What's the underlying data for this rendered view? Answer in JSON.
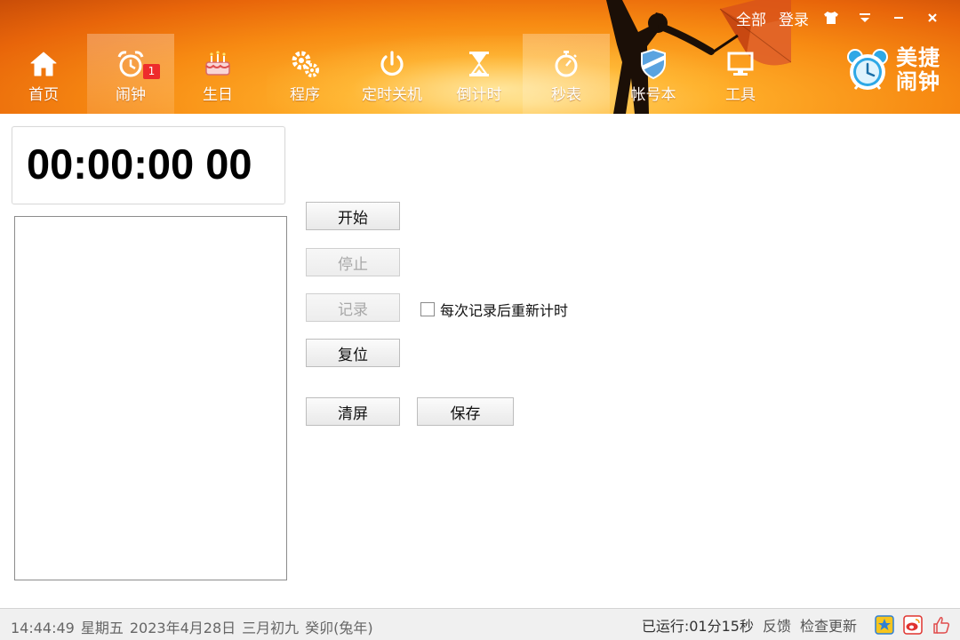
{
  "topbar": {
    "all_label": "全部",
    "login_label": "登录",
    "skin_icon": "tshirt-icon",
    "menu_icon": "menu-icon",
    "minimize_icon": "minimize-icon",
    "close_icon": "close-icon"
  },
  "nav": {
    "items": [
      {
        "label": "首页",
        "icon": "home-icon"
      },
      {
        "label": "闹钟",
        "icon": "alarm-clock-icon",
        "badge": "1"
      },
      {
        "label": "生日",
        "icon": "cake-icon"
      },
      {
        "label": "程序",
        "icon": "gears-icon"
      },
      {
        "label": "定时关机",
        "icon": "power-icon"
      },
      {
        "label": "倒计时",
        "icon": "hourglass-icon"
      },
      {
        "label": "秒表",
        "icon": "stopwatch-icon"
      },
      {
        "label": "帐号本",
        "icon": "shield-icon"
      },
      {
        "label": "工具",
        "icon": "monitor-icon"
      }
    ],
    "active_index": 6
  },
  "brand": {
    "name_line1": "美捷",
    "name_line2": "闹钟",
    "icon": "alarm-clock-logo-icon"
  },
  "stopwatch": {
    "display": "00:00:00 00",
    "buttons": {
      "start": "开始",
      "stop": "停止",
      "record": "记录",
      "reset": "复位",
      "clear": "清屏",
      "save": "保存"
    },
    "reset_after_record_label": "每次记录后重新计时",
    "reset_after_record_checked": false
  },
  "status": {
    "time": "14:44:49",
    "weekday": "星期五",
    "date": "2023年4月28日",
    "lunar_date": "三月初九",
    "ganzhi_year": "癸卯(兔年)",
    "running": "已运行:01分15秒",
    "feedback_label": "反馈",
    "check_update_label": "检查更新",
    "icons": [
      "qzone-icon",
      "weibo-icon",
      "thumbs-up-icon"
    ]
  }
}
